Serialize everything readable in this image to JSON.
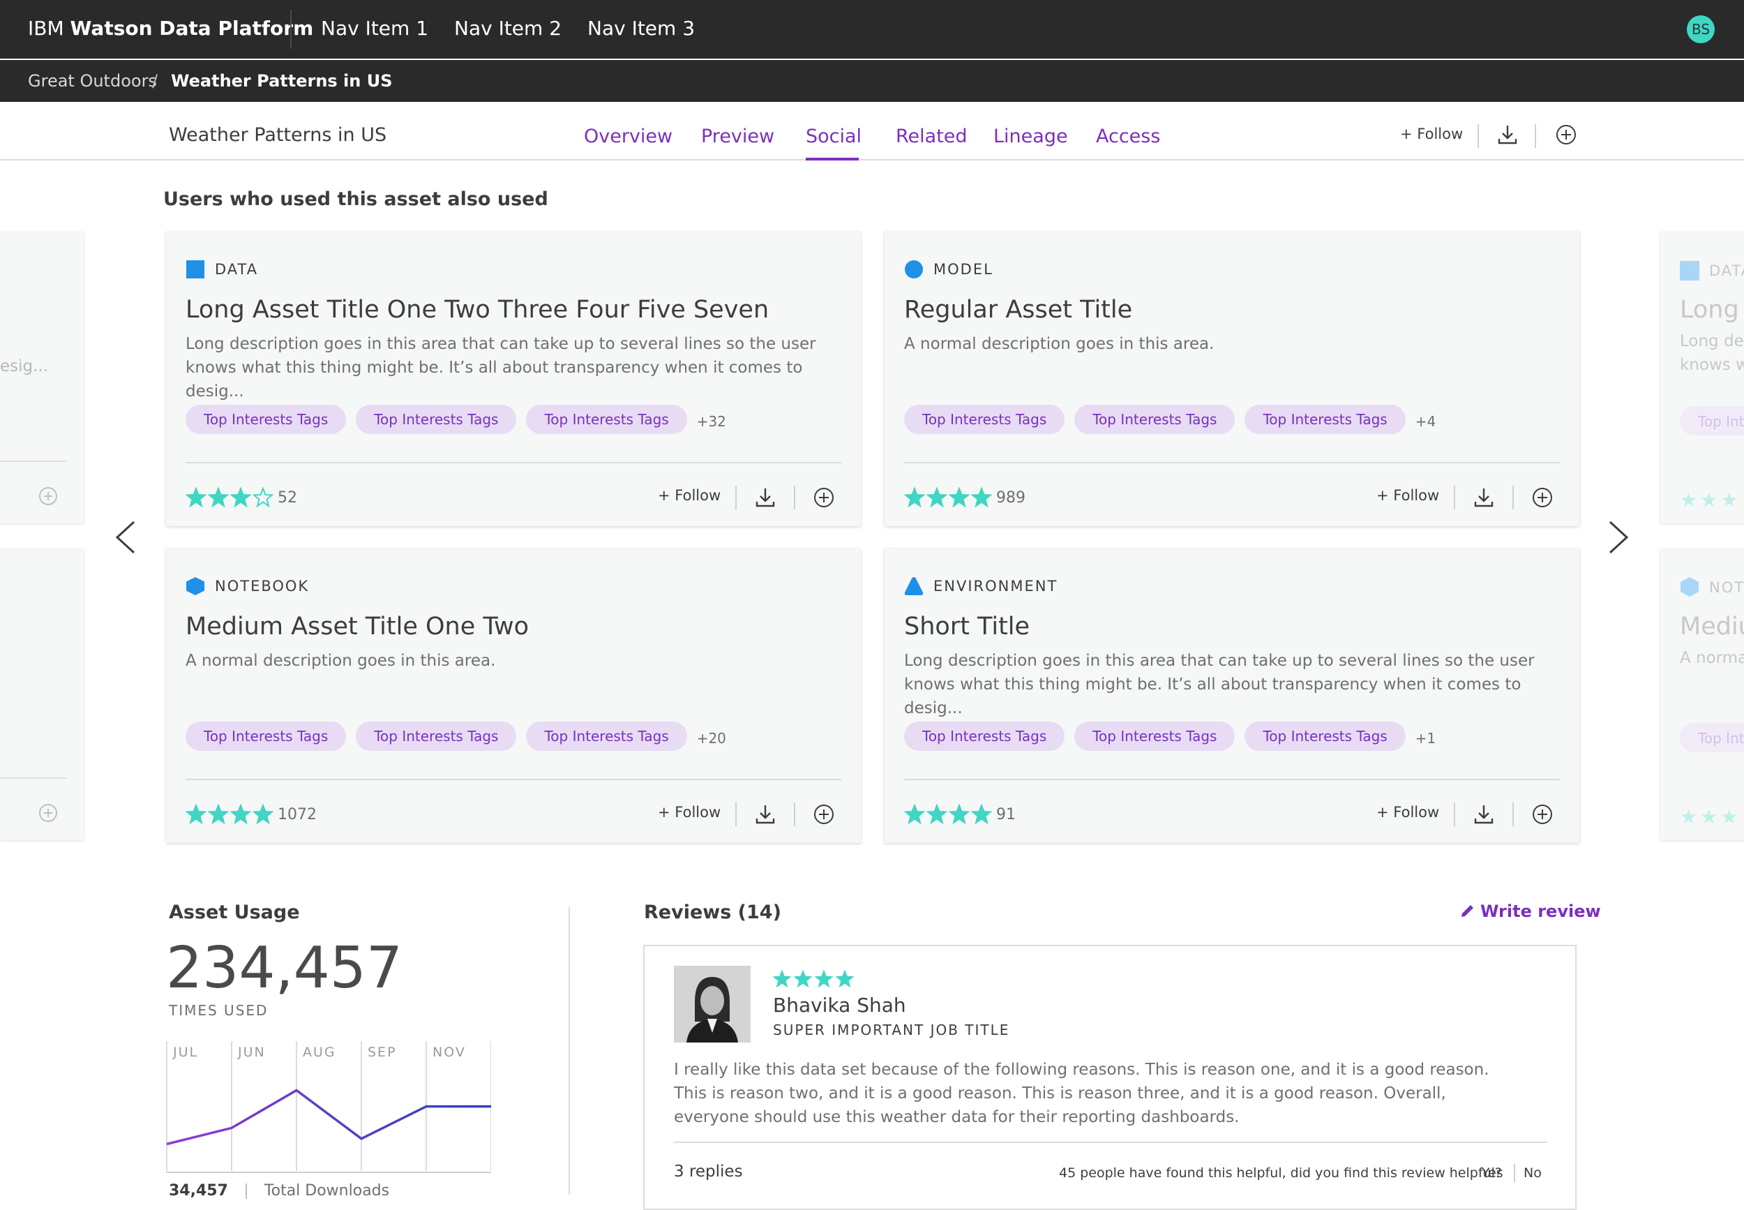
{
  "topbar": {
    "brand_prefix": "IBM",
    "brand_name": "Watson Data Platform",
    "nav": [
      "Nav Item 1",
      "Nav Item 2",
      "Nav Item 3"
    ],
    "avatar_initials": "BS"
  },
  "breadcrumb": {
    "parent": "Great Outdoors",
    "separator": "/",
    "current": "Weather Patterns in US"
  },
  "asset": {
    "title": "Weather Patterns in US",
    "tabs": [
      "Overview",
      "Preview",
      "Social",
      "Related",
      "Lineage",
      "Access"
    ],
    "active_tab": "Social",
    "follow_label": "+ Follow"
  },
  "section_title": "Users who used this asset also used",
  "cards": [
    {
      "type": "DATA",
      "title": "Long Asset Title One Two Three Four Five Seven",
      "description": "Long description goes in this area that can take up to several lines so the user knows what this thing might be. It’s all about transparency when it comes to desig...",
      "tags": [
        "Top Interests Tags",
        "Top Interests Tags",
        "Top Interests Tags"
      ],
      "more_tags": "+32",
      "rating": 3,
      "rating_max": 4,
      "count": "52",
      "follow": "+ Follow"
    },
    {
      "type": "MODEL",
      "title": "Regular Asset Title",
      "description": "A normal description goes in this area.",
      "tags": [
        "Top Interests Tags",
        "Top Interests Tags",
        "Top Interests Tags"
      ],
      "more_tags": "+4",
      "rating": 4,
      "rating_max": 4,
      "count": "989",
      "follow": "+ Follow"
    },
    {
      "type": "NOTEBOOK",
      "title": "Medium Asset Title One Two",
      "description": "A normal description goes in this area.",
      "tags": [
        "Top Interests Tags",
        "Top Interests Tags",
        "Top Interests Tags"
      ],
      "more_tags": "+20",
      "rating": 4,
      "rating_max": 4,
      "count": "1072",
      "follow": "+ Follow"
    },
    {
      "type": "ENVIRONMENT",
      "title": "Short Title",
      "description": "Long description goes in this area that can take up to several lines so the user knows what this thing might be. It’s all about transparency when it comes to desig...",
      "tags": [
        "Top Interests Tags",
        "Top Interests Tags",
        "Top Interests Tags"
      ],
      "more_tags": "+1",
      "rating": 4,
      "rating_max": 4,
      "count": "91",
      "follow": "+ Follow"
    }
  ],
  "ghost_cards": {
    "left_snippet": "esig...",
    "right_top_type": "DATA",
    "right_top_title": "Long A",
    "right_top_desc1": "Long des",
    "right_top_desc2": "knows w",
    "right_top_tag": "Top Inte",
    "right_bottom_type": "NOTE",
    "right_bottom_title": "Mediu",
    "right_bottom_desc": "A norma",
    "right_bottom_tag": "Top Inte"
  },
  "usage": {
    "title": "Asset Usage",
    "number": "234,457",
    "label": "TIMES USED",
    "footer_number": "34,457",
    "footer_label": "Total Downloads"
  },
  "chart_data": {
    "type": "line",
    "categories": [
      "JUL",
      "JUN",
      "AUG",
      "SEP",
      "NOV"
    ],
    "series": [
      {
        "values": [
          0.25,
          0.4,
          0.75,
          0.3,
          0.6,
          0.6
        ]
      }
    ],
    "ylim": [
      0,
      1
    ],
    "grid": true,
    "colors": [
      "#8a3fd1",
      "#2f3fbf"
    ]
  },
  "reviews": {
    "title": "Reviews (14)",
    "write_label": "Write review",
    "reviewer_name": "Bhavika Shah",
    "reviewer_job": "SUPER IMPORTANT JOB TITLE",
    "rating": 4,
    "text": "I really like this data set because of the following reasons. This is reason one, and it is a good reason. This is reason two, and it is a good reason. This is reason three, and it is a good reason. Overall, everyone should use this weather data for their reporting dashboards.",
    "replies": "3 replies",
    "helpful_text": "45 people have found this helpful, did you find this review helpful?",
    "yes": "Yes",
    "no": "No"
  },
  "colors": {
    "accent": "#7b2fbf",
    "star": "#41d6c3",
    "topbar": "#2a2a2a",
    "tag_bg": "#e7dcf4",
    "data_icon": "#1e90e8"
  }
}
